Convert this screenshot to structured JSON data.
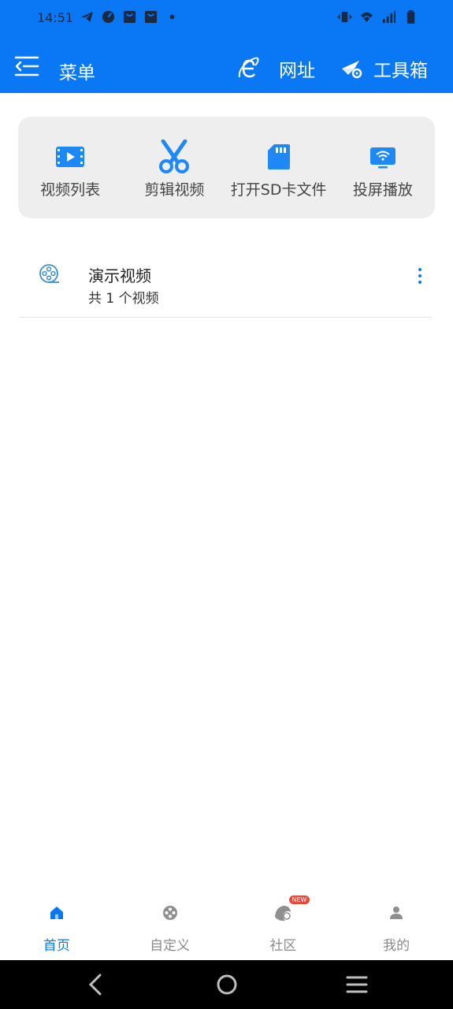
{
  "status_bar": {
    "time": "14:51",
    "left_icons": [
      "telegram-icon",
      "speedometer-icon",
      "shopping-bag-icon",
      "shopping-bag-icon",
      "dot-icon"
    ],
    "right_icons": [
      "vibrate-icon",
      "wifi-icon",
      "signal-icon",
      "battery-icon"
    ]
  },
  "app_bar": {
    "menu_label": "菜单",
    "url_label": "网址",
    "tools_label": "工具箱",
    "color": "#0a78f5"
  },
  "quick_actions": [
    {
      "label": "视频列表",
      "icon": "video-list-icon"
    },
    {
      "label": "剪辑视频",
      "icon": "scissors-icon"
    },
    {
      "label": "打开SD卡文件",
      "icon": "sd-card-icon"
    },
    {
      "label": "投屏播放",
      "icon": "screen-cast-icon"
    }
  ],
  "folders": [
    {
      "title": "演示视频",
      "count": "共 1 个视频",
      "icon": "film-reel-icon"
    }
  ],
  "bottom_nav": [
    {
      "label": "首页",
      "icon": "home-icon",
      "active": true
    },
    {
      "label": "自定义",
      "icon": "film-reel-icon",
      "active": false
    },
    {
      "label": "社区",
      "icon": "community-icon",
      "active": false,
      "badge": "NEW"
    },
    {
      "label": "我的",
      "icon": "person-icon",
      "active": false
    }
  ]
}
